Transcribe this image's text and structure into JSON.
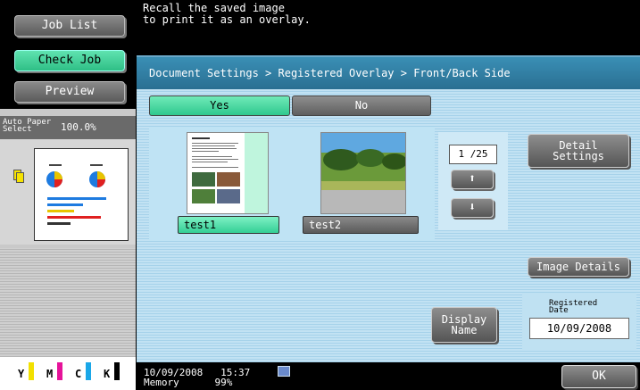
{
  "left_panel": {
    "job_list": "Job List",
    "check_job": "Check Job",
    "preview": "Preview",
    "paper_select": "Auto Paper Select",
    "zoom": "100.0%",
    "ink_labels": [
      "Y",
      "M",
      "C",
      "K"
    ],
    "ink_colors": [
      "#f2e000",
      "#e6139a",
      "#1aa7e8",
      "#000000"
    ]
  },
  "message": "Recall the saved image\nto print it as an overlay.",
  "breadcrumb": "Document Settings > Registered Overlay > Front/Back Side",
  "tabs": {
    "yes": "Yes",
    "no": "No"
  },
  "items": [
    {
      "name": "test1",
      "selected": true
    },
    {
      "name": "test2",
      "selected": false
    }
  ],
  "pager": {
    "current": "1",
    "total": "/25",
    "up": "⬆",
    "down": "⬇"
  },
  "buttons": {
    "detail_settings": "Detail\nSettings",
    "image_details": "Image Details",
    "display_name": "Display\nName",
    "ok": "OK"
  },
  "registered_date": {
    "label": "Registered\nDate",
    "value": "10/09/2008"
  },
  "status": {
    "datetime": "10/09/2008   15:37\nMemory      99%"
  },
  "colors": {
    "accent": "#2fc88e",
    "panel": "#b5dbef",
    "header": "#2f7fa5"
  }
}
